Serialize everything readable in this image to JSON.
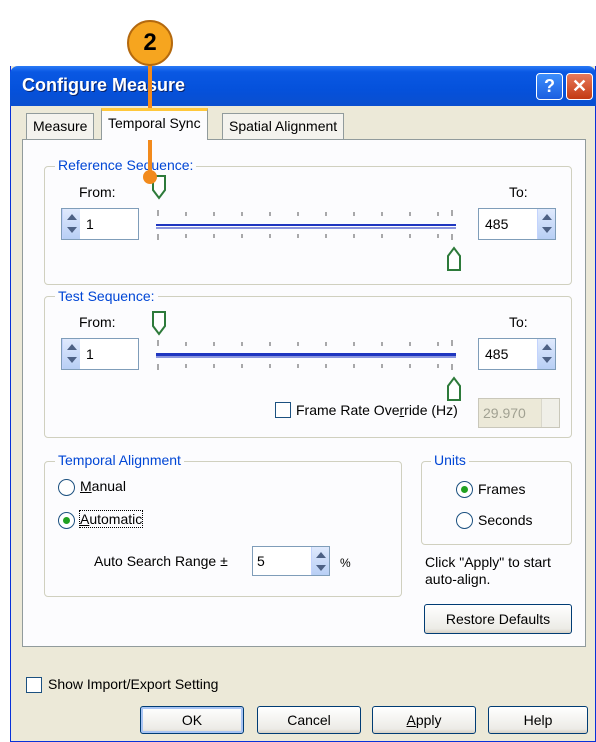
{
  "callout": {
    "number": "2"
  },
  "window": {
    "title": "Configure Measure",
    "help_glyph": "?",
    "close_glyph": "✕"
  },
  "tabs": [
    {
      "label": "Measure"
    },
    {
      "label": "Temporal Sync"
    },
    {
      "label": "Spatial Alignment"
    }
  ],
  "reference_sequence": {
    "legend": "Reference Sequence:",
    "from_label": "From:",
    "to_label": "To:",
    "from_value": "1",
    "to_value": "485"
  },
  "test_sequence": {
    "legend": "Test Sequence:",
    "from_label": "From:",
    "to_label": "To:",
    "from_value": "1",
    "to_value": "485"
  },
  "frame_rate": {
    "label_pre": "Frame Rate Ove",
    "label_u": "r",
    "label_post": "ride (Hz)",
    "value": "29.970"
  },
  "temporal_alignment": {
    "legend": "Temporal Alignment",
    "manual_u": "M",
    "manual_rest": "anual",
    "automatic_u": "A",
    "automatic_rest": "utomatic",
    "search_label": "Auto Search Range ±",
    "search_value": "5",
    "search_unit": "%"
  },
  "units": {
    "legend": "Units",
    "frames": "Frames",
    "seconds": "Seconds"
  },
  "hint_line1": "Click \"Apply\" to start",
  "hint_line2": "auto-align.",
  "restore_defaults": "Restore Defaults",
  "show_import_export": "Show Import/Export Setting",
  "buttons": {
    "ok": "OK",
    "cancel": "Cancel",
    "apply_u": "A",
    "apply_rest": "pply",
    "help": "Help"
  }
}
